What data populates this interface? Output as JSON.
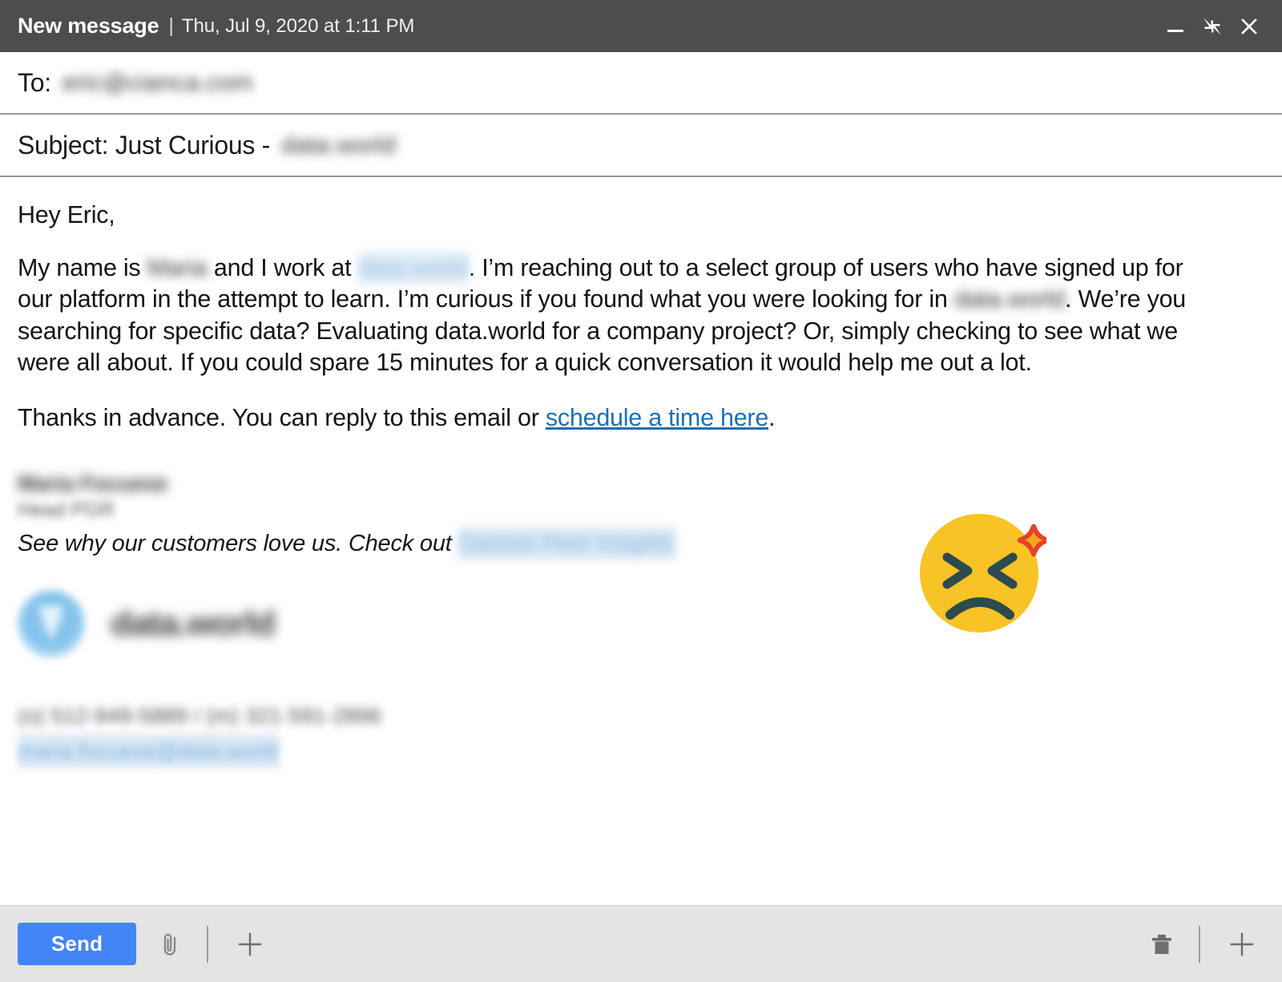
{
  "window": {
    "title": "New message",
    "separator": "|",
    "timestamp": "Thu, Jul 9, 2020 at 1:11 PM",
    "titlebar_color": "#4d4d4d",
    "controls": [
      {
        "name": "minimize-button",
        "icon": "minimize-icon"
      },
      {
        "name": "restore-button",
        "icon": "collapse-arrows-icon"
      },
      {
        "name": "close-button",
        "icon": "close-icon"
      }
    ]
  },
  "fields": {
    "to": {
      "label": "To:",
      "value": "eric@cianca.com",
      "redacted": true
    },
    "subject": {
      "label": "Subject: Just Curious -",
      "value": "data.world",
      "redacted": true
    }
  },
  "body": {
    "greeting": "Hey Eric,",
    "p1_part1": "My name is",
    "p1_redacted_name": "Maria",
    "p1_part2": "and I work at",
    "p1_redacted_company1": "data.world",
    "p1_part3": ". I’m reaching out to a select group of users who have signed up for our platform in the attempt to learn. I’m curious if you found what you were looking for in",
    "p1_redacted_company2": "data.world",
    "p1_part4": ". We’re you searching for specific data? Evaluating data.world for a company project? Or, simply checking to see what we were all about. If you could spare 15 minutes for a quick conversation it would help me out a lot.",
    "p2_part1": "Thanks in advance. You can reply to this email or",
    "p2_link": "schedule a time here",
    "p2_part2": ".",
    "link_color": "#1f6fb2"
  },
  "signature": {
    "name": "Maria Focuese",
    "title": "Head PGR",
    "tagline": "See why our customers love us. Check out",
    "tagline_link": "Gartner Peer Insights",
    "logo_text": "data.world",
    "phone": "(o) 512-949-5889 / (m) 321-591-2896",
    "email": "maria.focuese@data.world"
  },
  "emoji": {
    "name": "persevering-angry-face-emoji",
    "face_color": "#f7c325",
    "feature_color": "#2d4a4f",
    "anger_color": "#e8412b",
    "anger_highlight": "#f5a623"
  },
  "toolbar": {
    "send_label": "Send",
    "send_color": "#4285f4",
    "background": "#e4e4e4",
    "left_icons": [
      {
        "name": "attach-icon",
        "label": "attach"
      },
      {
        "name": "add-icon",
        "label": "add"
      }
    ],
    "right_icons": [
      {
        "name": "trash-icon",
        "label": "discard"
      },
      {
        "name": "add-icon",
        "label": "add"
      }
    ]
  }
}
